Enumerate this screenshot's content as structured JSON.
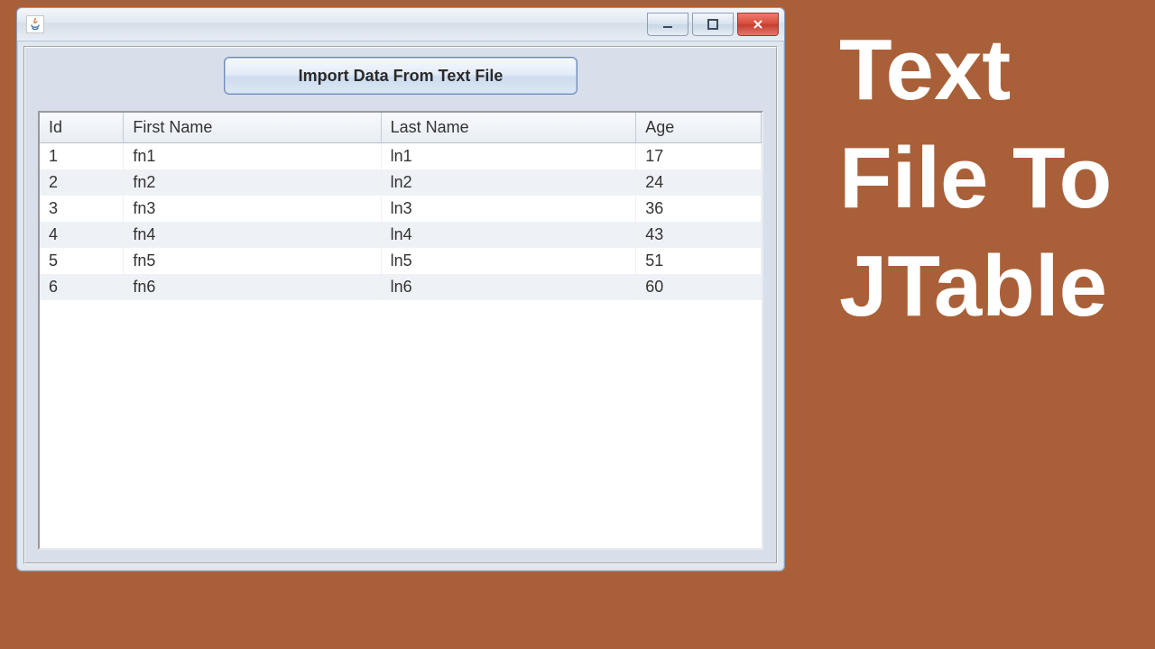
{
  "sideCaption": {
    "line1": "Text",
    "line2": "File To",
    "line3": "JTable"
  },
  "window": {
    "iconName": "java-icon"
  },
  "button": {
    "label": "Import Data From Text File"
  },
  "table": {
    "headers": [
      "Id",
      "First Name",
      "Last Name",
      "Age"
    ],
    "rows": [
      {
        "id": "1",
        "first": "fn1",
        "last": "ln1",
        "age": "17"
      },
      {
        "id": "2",
        "first": "fn2",
        "last": "ln2",
        "age": "24"
      },
      {
        "id": "3",
        "first": "fn3",
        "last": "ln3",
        "age": "36"
      },
      {
        "id": "4",
        "first": "fn4",
        "last": "ln4",
        "age": "43"
      },
      {
        "id": "5",
        "first": "fn5",
        "last": "ln5",
        "age": "51"
      },
      {
        "id": "6",
        "first": "fn6",
        "last": "ln6",
        "age": "60"
      }
    ]
  }
}
